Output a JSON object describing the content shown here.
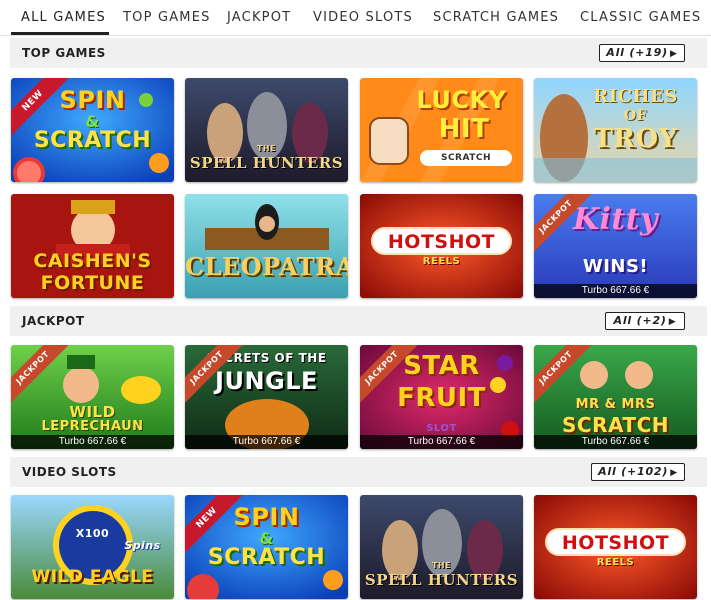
{
  "nav": {
    "items": [
      "ALL GAMES",
      "TOP GAMES",
      "JACKPOT",
      "VIDEO SLOTS",
      "SCRATCH GAMES",
      "CLASSIC GAMES"
    ]
  },
  "sections": {
    "top_games": {
      "title": "TOP GAMES",
      "all_label": "All (+19)"
    },
    "jackpot": {
      "title": "JACKPOT",
      "all_label": "All (+2)"
    },
    "video_slots": {
      "title": "VIDEO SLOTS",
      "all_label": "All (+102)"
    }
  },
  "games": {
    "spin_scratch": {
      "title1": "SPIN",
      "title2": "&",
      "title3": "SCRATCH",
      "badge": "NEW"
    },
    "spell_hunters": {
      "title1": "THE",
      "title2": "SPELL HUNTERS"
    },
    "lucky_hit": {
      "title1": "LUCKY",
      "title2": "HIT",
      "title3": "SCRATCH"
    },
    "riches_troy": {
      "title1": "RICHES",
      "title2": "OF",
      "title3": "TROY"
    },
    "caishens": {
      "title1": "CAISHEN'S",
      "title2": "FORTUNE"
    },
    "cleopatra": {
      "title1": "CLEOPATRA"
    },
    "hotshot": {
      "title1": "HOTSHOT",
      "title2": "REELS"
    },
    "kitty_wins": {
      "title1": "Kitty",
      "title2": "WINS!",
      "badge": "JACKPOT",
      "jackpot": "Turbo 667.66 €"
    },
    "wild_leprechaun": {
      "title1": "WILD",
      "title2": "LEPRECHAUN",
      "badge": "JACKPOT",
      "jackpot": "Turbo 667.66 €"
    },
    "secrets_jungle": {
      "title1": "SECRETS OF THE",
      "title2": "JUNGLE",
      "badge": "JACKPOT",
      "jackpot": "Turbo 667.66 €"
    },
    "star_fruit": {
      "title1": "STAR",
      "title2": "FRUIT",
      "title3": "SLOT",
      "badge": "JACKPOT",
      "jackpot": "Turbo 667.66 €"
    },
    "mr_mrs_scratch": {
      "title1": "MR & MRS",
      "title2": "SCRATCH",
      "badge": "JACKPOT",
      "jackpot": "Turbo 667.66 €"
    },
    "wild_eagle": {
      "title1": "WILD EAGLE",
      "title2": "Spins",
      "wheel": "X100"
    },
    "spin_scratch_2": {
      "title1": "SPIN",
      "title2": "&",
      "title3": "SCRATCH",
      "badge": "NEW"
    },
    "spell_hunters_2": {
      "title1": "THE",
      "title2": "SPELL HUNTERS"
    },
    "hotshot_2": {
      "title1": "HOTSHOT",
      "title2": "REELS"
    }
  },
  "colors": {
    "section_bar": "#f0f0f0",
    "new_ribbon": "#c8192c",
    "jackpot_ribbon": "#c7492b",
    "title_gold": "#ffe14a"
  }
}
